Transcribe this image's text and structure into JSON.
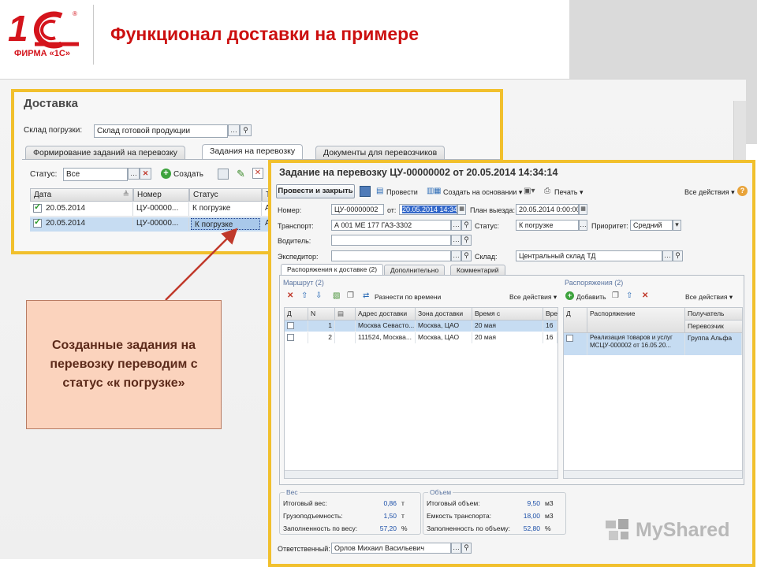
{
  "logo": {
    "brand": "1С",
    "company": "ФИРМА «1С»"
  },
  "slide_title": "Функционал доставки на примере",
  "callout": "Созданные задания на перевозку переводим с статус «к погрузке»",
  "watermark": "MyShared",
  "colors": {
    "title_red": "#cc1010",
    "frame_yellow": "#f1c02d",
    "callout_fill": "#fbd3bd",
    "arrow": "#c0392b"
  },
  "win1": {
    "title": "Доставка",
    "warehouse_label": "Склад погрузки:",
    "warehouse_value": "Склад готовой продукции",
    "tabs": [
      "Формирование заданий на перевозку",
      "Задания на перевозку",
      "Документы для перевозчиков"
    ],
    "status_label": "Статус:",
    "status_value": "Все",
    "create_label": "Создать",
    "columns": [
      "Дата",
      "Номер",
      "Статус",
      "Тр"
    ],
    "rows": [
      {
        "date": "20.05.2014",
        "number": "ЦУ-00000...",
        "status": "К погрузке",
        "tr": "А"
      },
      {
        "date": "20.05.2014",
        "number": "ЦУ-00000...",
        "status": "К погрузке",
        "tr": "А"
      }
    ]
  },
  "win2": {
    "title": "Задание на перевозку ЦУ-00000002 от 20.05.2014 14:34:14",
    "toolbar": {
      "post_close": "Провести и закрыть",
      "post": "Провести",
      "create_based": "Создать на основании",
      "print": "Печать",
      "all_actions": "Все действия",
      "help": "?"
    },
    "fields": {
      "number_label": "Номер:",
      "number": "ЦУ-00000002",
      "from_label": "от:",
      "from": "20.05.2014 14:34:14",
      "plan_label": "План выезда:",
      "plan": "20.05.2014 0:00:00",
      "transport_label": "Транспорт:",
      "transport": "А 001 МЕ 177 ГАЗ-3302",
      "status_label": "Статус:",
      "status": "К погрузке",
      "priority_label": "Приоритет:",
      "priority": "Средний",
      "driver_label": "Водитель:",
      "driver": "",
      "forwarder_label": "Экспедитор:",
      "forwarder": "",
      "warehouse_label": "Склад:",
      "warehouse": "Центральный склад ТД",
      "responsible_label": "Ответственный:",
      "responsible": "Орлов Михаил Васильевич"
    },
    "tabs": [
      "Распоряжения к доставке (2)",
      "Дополнительно",
      "Комментарий"
    ],
    "route": {
      "title": "Маршрут (2)",
      "distribute": "Разнести по времени",
      "all_actions": "Все действия",
      "columns": [
        "Д",
        "N",
        "",
        "Адрес доставки",
        "Зона доставки",
        "Время с",
        "Вре"
      ],
      "rows": [
        {
          "n": "1",
          "address": "Москва Севасто...",
          "zone": "Москва, ЦАО",
          "time": "20 мая",
          "t2": "16"
        },
        {
          "n": "2",
          "address": "111524, Москва...",
          "zone": "Москва, ЦАО",
          "time": "20 мая",
          "t2": "16"
        }
      ]
    },
    "orders": {
      "title": "Распоряжения (2)",
      "add": "Добавить",
      "all_actions": "Все действия",
      "columns": [
        "Д",
        "Распоряжение",
        "Получатель"
      ],
      "subheader": "Перевозчик",
      "rows": [
        {
          "order": "Реализация товаров и услуг МСЦУ-000002 от 16.05.20...",
          "recipient": "Группа Альфа"
        }
      ]
    },
    "weight": {
      "title": "Вес",
      "total_label": "Итоговый вес:",
      "total": "0,86",
      "total_unit": "т",
      "capacity_label": "Грузоподъемность:",
      "capacity": "1,50",
      "capacity_unit": "т",
      "fill_label": "Заполненность по весу:",
      "fill": "57,20",
      "fill_unit": "%"
    },
    "volume": {
      "title": "Объем",
      "total_label": "Итоговый объем:",
      "total": "9,50",
      "total_unit": "м3",
      "capacity_label": "Емкость транспорта:",
      "capacity": "18,00",
      "capacity_unit": "м3",
      "fill_label": "Заполненность по объему:",
      "fill": "52,80",
      "fill_unit": "%"
    }
  }
}
